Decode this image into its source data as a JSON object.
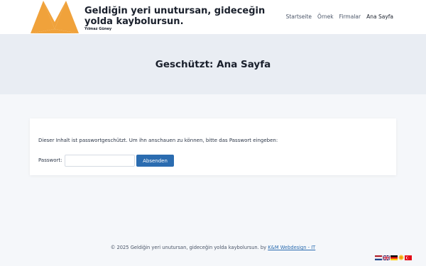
{
  "header": {
    "site_title": "Geldiğin yeri unutursan, gideceğin yolda kaybolursun.",
    "tagline": "Yılmaz Güney",
    "colors": {
      "logo": "#f0a23b",
      "background": "#ffffff"
    }
  },
  "nav": {
    "items": [
      {
        "label": "Startseite"
      },
      {
        "label": "Örnek"
      },
      {
        "label": "Firmalar"
      },
      {
        "label": "Ana Sayfa"
      }
    ]
  },
  "page": {
    "title": "Geschützt: Ana Sayfa"
  },
  "form": {
    "info": "Dieser Inhalt ist passwortgeschützt. Um ihn anschauen zu können, bitte das Passwort eingeben:",
    "password_label": "Passwort:",
    "password_value": "",
    "submit_label": "Absenden",
    "button_color": "#2b6cb0"
  },
  "footer": {
    "text": "© 2025 Geldiğin yeri unutursan, gideceğin yolda kaybolursun. by ",
    "link_label": "K&M Webdesign - IT"
  },
  "language_flags": [
    {
      "icon": "flag-netherlands-icon"
    },
    {
      "icon": "flag-uk-icon"
    },
    {
      "icon": "flag-germany-icon"
    },
    {
      "icon": "flag-sun-icon"
    },
    {
      "icon": "flag-turkey-icon"
    }
  ]
}
